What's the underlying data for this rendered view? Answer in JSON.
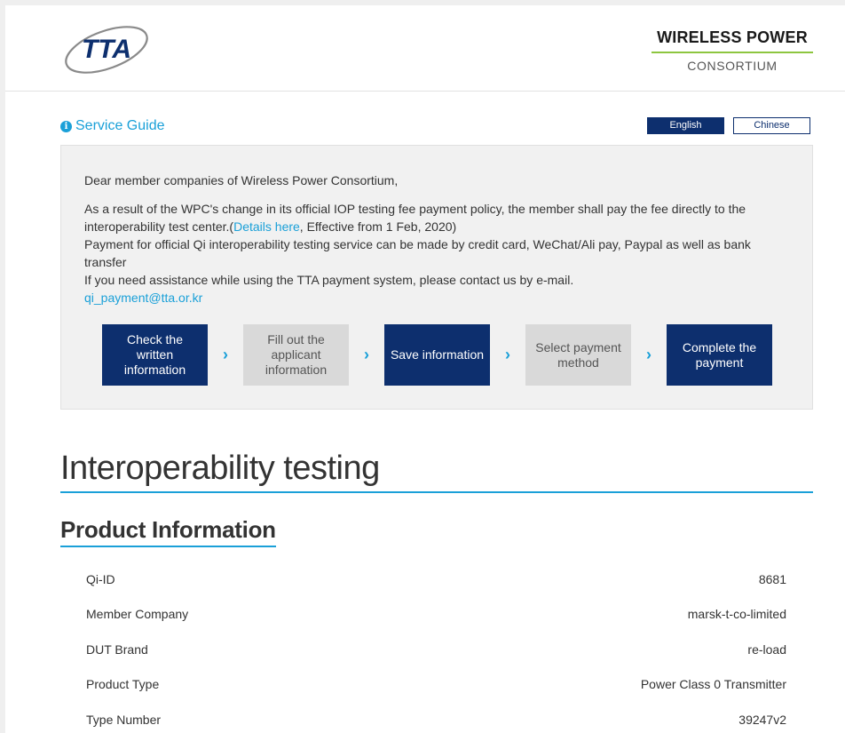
{
  "header": {
    "tta_logo_text": "TTA",
    "wpc_title": "WIRELESS POWER",
    "wpc_subtitle": "CONSORTIUM"
  },
  "service_guide": {
    "label": "Service Guide",
    "icon": "info-icon"
  },
  "languages": {
    "english": "English",
    "chinese": "Chinese"
  },
  "notice": {
    "greeting": "Dear member companies of Wireless Power Consortium,",
    "para1_before_link": "As a result of the WPC's change in its official IOP testing fee payment policy, the member shall pay the fee directly to the interoperability test center.(",
    "details_link": "Details here",
    "para1_after_link": ", Effective from 1 Feb, 2020)",
    "para2": "Payment for official Qi interoperability testing service can be made by credit card, WeChat/Ali pay, Paypal as well as bank transfer",
    "para3": "If you need assistance while using the TTA payment system, please contact us by e-mail.",
    "email": "qi_payment@tta.or.kr"
  },
  "steps": [
    {
      "label": "Check the written information",
      "active": true
    },
    {
      "label": "Fill out the applicant information",
      "active": false
    },
    {
      "label": "Save information",
      "active": true
    },
    {
      "label": "Select payment method",
      "active": false
    },
    {
      "label": "Complete the payment",
      "active": true
    }
  ],
  "colors": {
    "navy": "#0d2f6e",
    "accent_blue": "#1aa0d8",
    "green": "#8dc63f",
    "inactive_gray": "#d9d9d9"
  },
  "main_title": "Interoperability testing",
  "section_title": "Product Information",
  "product_info": [
    {
      "label": "Qi-ID",
      "value": "8681"
    },
    {
      "label": "Member Company",
      "value": "marsk-t-co-limited"
    },
    {
      "label": "DUT Brand",
      "value": "re-load"
    },
    {
      "label": "Product Type",
      "value": "Power Class 0 Transmitter"
    },
    {
      "label": "Type Number",
      "value": "39247v2"
    }
  ]
}
